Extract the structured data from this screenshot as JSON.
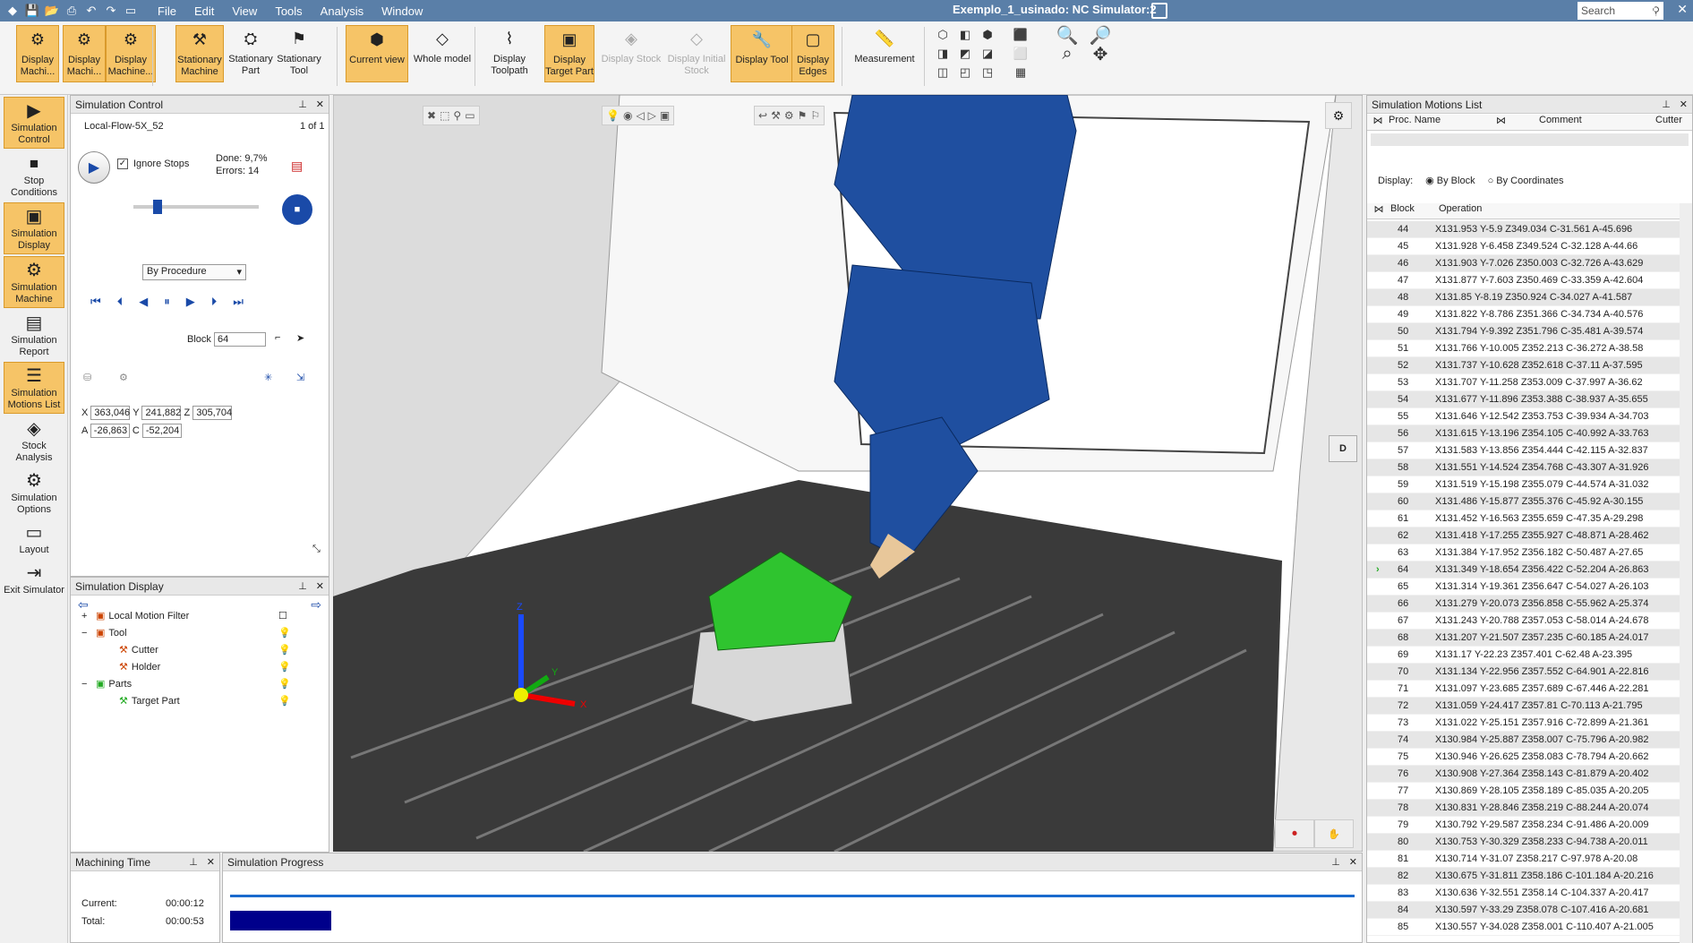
{
  "titlebar": {
    "window_title": "Exemplo_1_usinado: NC Simulator:2",
    "search_placeholder": "Search",
    "menus": [
      "File",
      "Edit",
      "View",
      "Tools",
      "Analysis",
      "Window"
    ]
  },
  "ribbon": {
    "buttons": [
      {
        "label": "Display Machi...",
        "on": true
      },
      {
        "label": "Display Machi...",
        "on": true
      },
      {
        "label": "Display Machine...",
        "on": true
      },
      {
        "label": "Stationary Machine",
        "on": true
      },
      {
        "label": "Stationary Part",
        "on": false
      },
      {
        "label": "Stationary Tool",
        "on": false
      },
      {
        "label": "Current view",
        "on": true
      },
      {
        "label": "Whole model",
        "on": false
      },
      {
        "label": "Display Toolpath",
        "on": false
      },
      {
        "label": "Display Target Part",
        "on": true
      },
      {
        "label": "Display Stock",
        "on": false,
        "dis": true
      },
      {
        "label": "Display Initial Stock",
        "on": false,
        "dis": true
      },
      {
        "label": "Display Tool",
        "on": true
      },
      {
        "label": "Display Edges",
        "on": true
      },
      {
        "label": "Measurement",
        "on": false
      }
    ]
  },
  "lefttools": [
    {
      "label": "Simulation Control",
      "on": true,
      "icon": "▶"
    },
    {
      "label": "Stop Conditions",
      "on": false,
      "icon": "⏹"
    },
    {
      "label": "Simulation Display",
      "on": true,
      "icon": "▣"
    },
    {
      "label": "Simulation Machine",
      "on": true,
      "icon": "⚙"
    },
    {
      "label": "Simulation Report",
      "on": false,
      "icon": "▤"
    },
    {
      "label": "Simulation Motions List",
      "on": true,
      "icon": "☰"
    },
    {
      "label": "Stock Analysis",
      "on": false,
      "icon": "◈"
    },
    {
      "label": "Simulation Options",
      "on": false,
      "icon": "⚙"
    },
    {
      "label": "Layout",
      "on": false,
      "icon": "▭"
    },
    {
      "label": "Exit Simulator",
      "on": false,
      "icon": "⇥"
    }
  ],
  "simcontrol": {
    "title": "Simulation Control",
    "procedure": "Local-Flow-5X_52",
    "page": "1 of 1",
    "ignore_stops": "Ignore Stops",
    "done": "Done:  9,7%",
    "errors": "Errors:  14",
    "mode": "By Procedure",
    "block_label": "Block",
    "block_value": "64",
    "coords": {
      "x_label": "X",
      "x": "363,046",
      "y_label": "Y",
      "y": "241,882",
      "z_label": "Z",
      "z": "305,704",
      "a_label": "A",
      "a": "-26,863",
      "c_label": "C",
      "c": "-52,204"
    }
  },
  "simdisplay": {
    "title": "Simulation Display",
    "tree": [
      {
        "label": "Local Motion Filter",
        "indent": 0,
        "icon": "+"
      },
      {
        "label": "Tool",
        "indent": 0,
        "icon": "−"
      },
      {
        "label": "Cutter",
        "indent": 1,
        "icon": ""
      },
      {
        "label": "Holder",
        "indent": 1,
        "icon": ""
      },
      {
        "label": "Parts",
        "indent": 0,
        "icon": "−"
      },
      {
        "label": "Target Part",
        "indent": 1,
        "icon": ""
      }
    ]
  },
  "machtime": {
    "title": "Machining Time",
    "current_label": "Current:",
    "current": "00:00:12",
    "total_label": "Total:",
    "total": "00:00:53"
  },
  "progress": {
    "title": "Simulation Progress",
    "fraction": 0.09
  },
  "motions": {
    "title": "Simulation Motions List",
    "columns": [
      "Proc. Name",
      "Comment",
      "Cutter"
    ],
    "display_label": "Display:",
    "by_block": "By Block",
    "by_coords": "By Coordinates",
    "table_headers": [
      "Block",
      "Operation"
    ],
    "rows": [
      {
        "b": "44",
        "o": "X131.953 Y-5.9 Z349.034 C-31.561 A-45.696"
      },
      {
        "b": "45",
        "o": "X131.928 Y-6.458 Z349.524 C-32.128 A-44.66"
      },
      {
        "b": "46",
        "o": "X131.903 Y-7.026 Z350.003 C-32.726 A-43.629"
      },
      {
        "b": "47",
        "o": "X131.877 Y-7.603 Z350.469 C-33.359 A-42.604"
      },
      {
        "b": "48",
        "o": "X131.85 Y-8.19 Z350.924 C-34.027 A-41.587"
      },
      {
        "b": "49",
        "o": "X131.822 Y-8.786 Z351.366 C-34.734 A-40.576"
      },
      {
        "b": "50",
        "o": "X131.794 Y-9.392 Z351.796 C-35.481 A-39.574"
      },
      {
        "b": "51",
        "o": "X131.766 Y-10.005 Z352.213 C-36.272 A-38.58"
      },
      {
        "b": "52",
        "o": "X131.737 Y-10.628 Z352.618 C-37.11 A-37.595"
      },
      {
        "b": "53",
        "o": "X131.707 Y-11.258 Z353.009 C-37.997 A-36.62"
      },
      {
        "b": "54",
        "o": "X131.677 Y-11.896 Z353.388 C-38.937 A-35.655"
      },
      {
        "b": "55",
        "o": "X131.646 Y-12.542 Z353.753 C-39.934 A-34.703"
      },
      {
        "b": "56",
        "o": "X131.615 Y-13.196 Z354.105 C-40.992 A-33.763"
      },
      {
        "b": "57",
        "o": "X131.583 Y-13.856 Z354.444 C-42.115 A-32.837"
      },
      {
        "b": "58",
        "o": "X131.551 Y-14.524 Z354.768 C-43.307 A-31.926"
      },
      {
        "b": "59",
        "o": "X131.519 Y-15.198 Z355.079 C-44.574 A-31.032"
      },
      {
        "b": "60",
        "o": "X131.486 Y-15.877 Z355.376 C-45.92 A-30.155"
      },
      {
        "b": "61",
        "o": "X131.452 Y-16.563 Z355.659 C-47.35 A-29.298"
      },
      {
        "b": "62",
        "o": "X131.418 Y-17.255 Z355.927 C-48.871 A-28.462"
      },
      {
        "b": "63",
        "o": "X131.384 Y-17.952 Z356.182 C-50.487 A-27.65"
      },
      {
        "b": "64",
        "o": "X131.349 Y-18.654 Z356.422 C-52.204 A-26.863"
      },
      {
        "b": "65",
        "o": "X131.314 Y-19.361 Z356.647 C-54.027 A-26.103"
      },
      {
        "b": "66",
        "o": "X131.279 Y-20.073 Z356.858 C-55.962 A-25.374"
      },
      {
        "b": "67",
        "o": "X131.243 Y-20.788 Z357.053 C-58.014 A-24.678"
      },
      {
        "b": "68",
        "o": "X131.207 Y-21.507 Z357.235 C-60.185 A-24.017"
      },
      {
        "b": "69",
        "o": "X131.17 Y-22.23 Z357.401 C-62.48 A-23.395"
      },
      {
        "b": "70",
        "o": "X131.134 Y-22.956 Z357.552 C-64.901 A-22.816"
      },
      {
        "b": "71",
        "o": "X131.097 Y-23.685 Z357.689 C-67.446 A-22.281"
      },
      {
        "b": "72",
        "o": "X131.059 Y-24.417 Z357.81 C-70.113 A-21.795"
      },
      {
        "b": "73",
        "o": "X131.022 Y-25.151 Z357.916 C-72.899 A-21.361"
      },
      {
        "b": "74",
        "o": "X130.984 Y-25.887 Z358.007 C-75.796 A-20.982"
      },
      {
        "b": "75",
        "o": "X130.946 Y-26.625 Z358.083 C-78.794 A-20.662"
      },
      {
        "b": "76",
        "o": "X130.908 Y-27.364 Z358.143 C-81.879 A-20.402"
      },
      {
        "b": "77",
        "o": "X130.869 Y-28.105 Z358.189 C-85.035 A-20.205"
      },
      {
        "b": "78",
        "o": "X130.831 Y-28.846 Z358.219 C-88.244 A-20.074"
      },
      {
        "b": "79",
        "o": "X130.792 Y-29.587 Z358.234 C-91.486 A-20.009"
      },
      {
        "b": "80",
        "o": "X130.753 Y-30.329 Z358.233 C-94.738 A-20.011"
      },
      {
        "b": "81",
        "o": "X130.714 Y-31.07 Z358.217 C-97.978 A-20.08"
      },
      {
        "b": "82",
        "o": "X130.675 Y-31.811 Z358.186 C-101.184 A-20.216"
      },
      {
        "b": "83",
        "o": "X130.636 Y-32.551 Z358.14 C-104.337 A-20.417"
      },
      {
        "b": "84",
        "o": "X130.597 Y-33.29 Z358.078 C-107.416 A-20.681"
      },
      {
        "b": "85",
        "o": "X130.557 Y-34.028 Z358.001 C-110.407 A-21.005"
      }
    ],
    "current_block": "64"
  },
  "viewport": {
    "axis_x": "X",
    "axis_y": "Y",
    "axis_z": "Z"
  },
  "colors": {
    "accent": "#f6c467",
    "title": "#5a7fa8",
    "spindle": "#1f4fa0",
    "part": "#2fc42f",
    "progress": "#00008b"
  }
}
